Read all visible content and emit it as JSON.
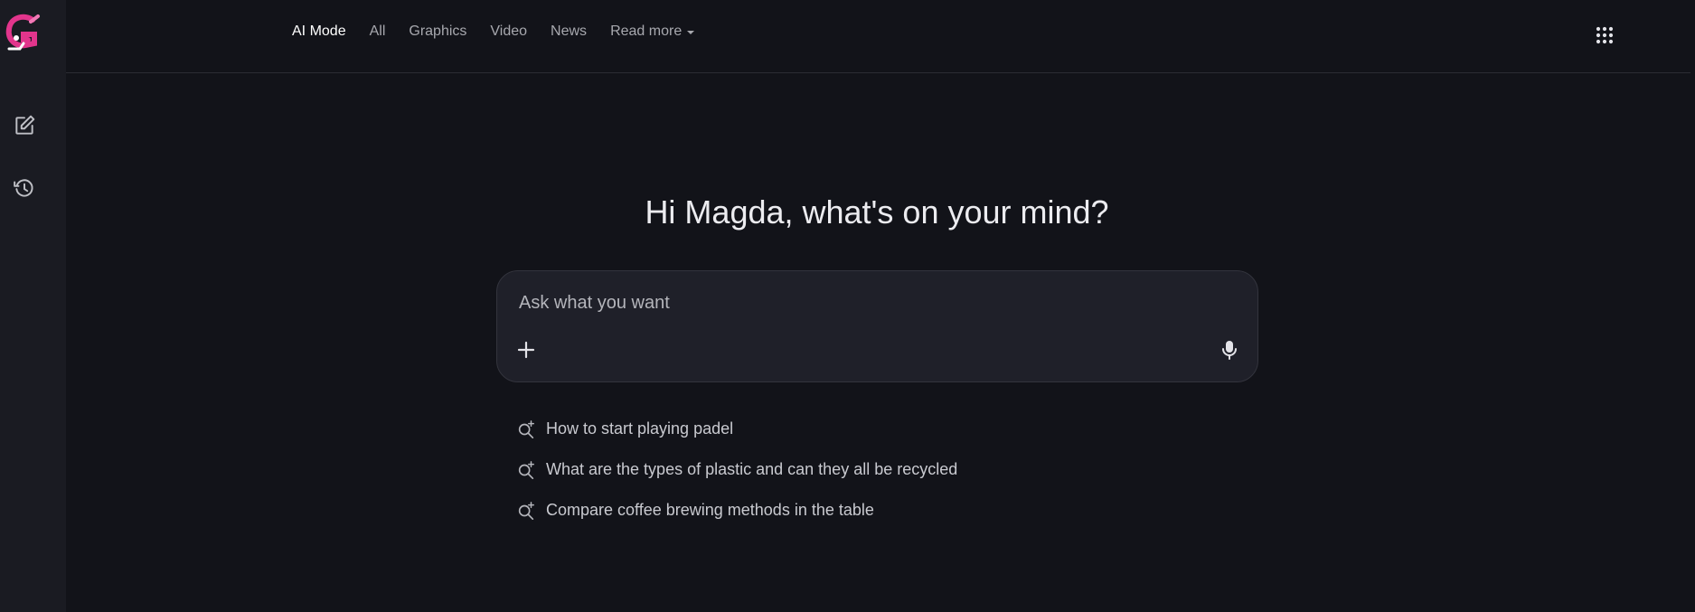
{
  "nav": {
    "items": [
      {
        "label": "AI Mode",
        "active": true
      },
      {
        "label": "All",
        "active": false
      },
      {
        "label": "Graphics",
        "active": false
      },
      {
        "label": "Video",
        "active": false
      },
      {
        "label": "News",
        "active": false
      }
    ],
    "more_label": "Read more"
  },
  "sidebar": {
    "logo_icon": "brand-logo",
    "items": [
      {
        "icon": "edit-icon",
        "name": "new-chat"
      },
      {
        "icon": "history-icon",
        "name": "history"
      }
    ]
  },
  "header": {
    "apps_icon": "apps-grid-icon",
    "avatar_icon": "avatar"
  },
  "main": {
    "greeting": "Hi Magda, what's on your mind?",
    "search": {
      "placeholder": "Ask what you want",
      "value": ""
    },
    "suggestions": [
      "How to start playing padel",
      "What are the types of plastic and can they all be recycled",
      "Compare coffee brewing methods in the table"
    ]
  },
  "colors": {
    "background": "#121319",
    "rail": "#1a1b22",
    "search_box": "#1f2029",
    "logo_accent": "#e2358c"
  }
}
